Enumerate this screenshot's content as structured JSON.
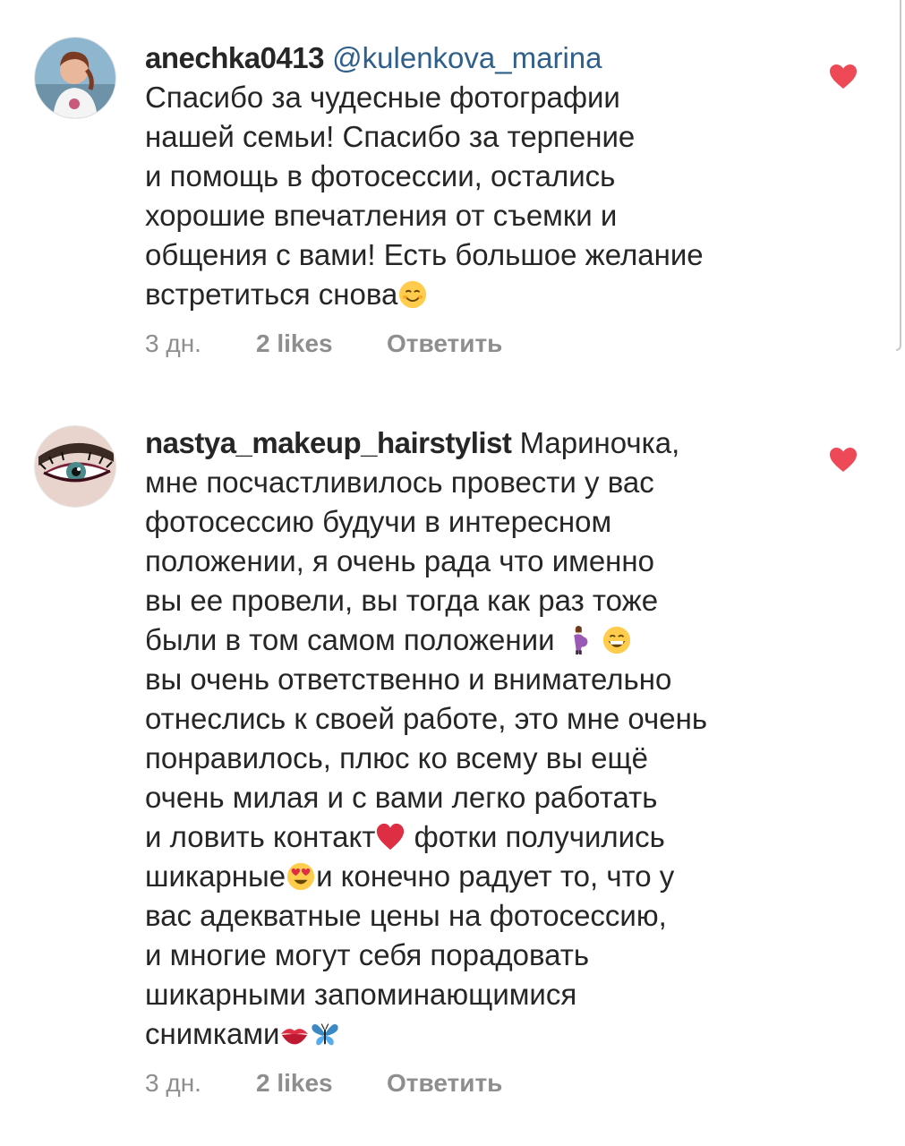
{
  "comments": [
    {
      "username": "anechka0413",
      "mention": "@kulenkova_marina",
      "lines": [
        "Спасибо за чудесные фотографии",
        "нашей семьи! Спасибо за терпение",
        "и помощь в фотосессии, остались",
        "хорошие впечатления от съемки и",
        "общения с вами!  Есть большое желание",
        "встретиться снова"
      ],
      "time": "3 дн.",
      "likes": "2 likes",
      "reply": "Ответить",
      "liked": true,
      "avatar_icon": "woman-portrait-avatar"
    },
    {
      "username": "nastya_makeup_hairstylist",
      "lines": [
        "Мариночка,",
        "мне посчастливилось провести у вас",
        "фотосессию будучи в интересном",
        "положении, я очень рада что именно",
        "вы ее провели, вы тогда как раз тоже",
        "были в том самом положении",
        "вы очень ответственно и внимательно",
        "отнеслись к своей работе, это мне очень",
        "понравилось, плюс ко всему вы ещё",
        "очень милая и с вами легко работать",
        "и ловить контакт",
        "фотки получились",
        "шикарные",
        "и конечно радует то, что у",
        "вас адекватные цены на фотосессию,",
        "и многие могут себя порадовать",
        "шикарными запоминающимися",
        "снимками"
      ],
      "time": "3 дн.",
      "likes": "2 likes",
      "reply": "Ответить",
      "liked": true,
      "avatar_icon": "eye-makeup-avatar"
    }
  ],
  "icons": {
    "like": "heart-icon",
    "emoji_smile": "smiling-face-emoji",
    "emoji_pregnant": "pregnant-woman-emoji",
    "emoji_grin": "grinning-face-emoji",
    "emoji_heart": "red-heart-emoji",
    "emoji_heart_eyes": "heart-eyes-emoji",
    "emoji_kiss": "kiss-mark-emoji",
    "emoji_butterfly": "butterfly-emoji"
  },
  "colors": {
    "text": "#262626",
    "meta": "#8e8e8e",
    "heart": "#ed4956",
    "mention": "#2f5f8a"
  }
}
